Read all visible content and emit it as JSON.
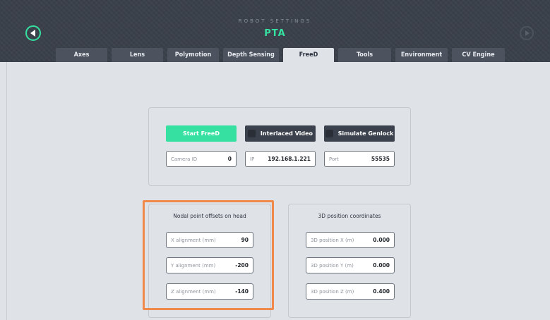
{
  "header": {
    "supertitle": "ROBOT SETTINGS",
    "title": "PTA",
    "accent_color": "#35e0a0",
    "nav_left_icon": "chevron-left-icon",
    "nav_right_icon": "chevron-right-icon"
  },
  "tabs": [
    {
      "label": "Axes",
      "active": false
    },
    {
      "label": "Lens",
      "active": false
    },
    {
      "label": "Polymotion",
      "active": false
    },
    {
      "label": "Depth Sensing",
      "active": false
    },
    {
      "label": "FreeD",
      "active": true
    },
    {
      "label": "Tools",
      "active": false
    },
    {
      "label": "Environment",
      "active": false
    },
    {
      "label": "CV Engine",
      "active": false
    }
  ],
  "freed": {
    "start_label": "Start FreeD",
    "interlaced_label": "Interlaced Video",
    "genlock_label": "Simulate Genlock",
    "camera_id": {
      "label": "Camera ID",
      "value": "0"
    },
    "ip": {
      "label": "IP",
      "value": "192.168.1.221"
    },
    "port": {
      "label": "Port",
      "value": "55535"
    }
  },
  "nodal": {
    "title": "Nodal point offsets on head",
    "x": {
      "label": "X alignment (mm)",
      "value": "90"
    },
    "y": {
      "label": "Y alignment (mm)",
      "value": "-200"
    },
    "z": {
      "label": "Z  alignment (mm)",
      "value": "-140"
    }
  },
  "position": {
    "title": "3D position coordinates",
    "x": {
      "label": "3D position X (m)",
      "value": "0.000"
    },
    "y": {
      "label": "3D position Y (m)",
      "value": "0.000"
    },
    "z": {
      "label": "3D position Z (m)",
      "value": "0.400"
    }
  },
  "colors": {
    "highlight": "#f08a4b",
    "header_bg": "#3b414b",
    "content_bg": "#dfe3e8"
  }
}
